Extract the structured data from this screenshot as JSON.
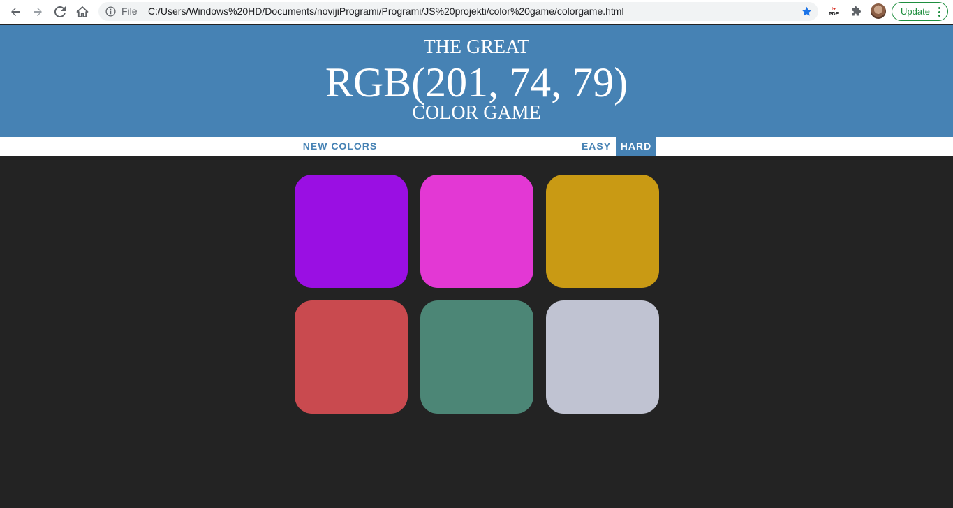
{
  "browser": {
    "file_label": "File",
    "url": "C:/Users/Windows%20HD/Documents/novijiProgrami/Programi/JS%20projekti/color%20game/colorgame.html",
    "pdf_ext_text": "PDF",
    "update_label": "Update"
  },
  "header": {
    "line1": "THE GREAT",
    "rgb": "RGB(201, 74, 79)",
    "line3": "COLOR GAME",
    "background": "#4682b4"
  },
  "stripe": {
    "new_colors": "NEW COLORS",
    "easy": "EASY",
    "hard": "HARD",
    "selected_mode": "HARD"
  },
  "squares": [
    {
      "color": "#9a0fe3"
    },
    {
      "color": "#e338d4"
    },
    {
      "color": "#c99a14"
    },
    {
      "color": "#c94a4f"
    },
    {
      "color": "#4c8676"
    },
    {
      "color": "#c0c3d2"
    }
  ],
  "page_background": "#232323"
}
